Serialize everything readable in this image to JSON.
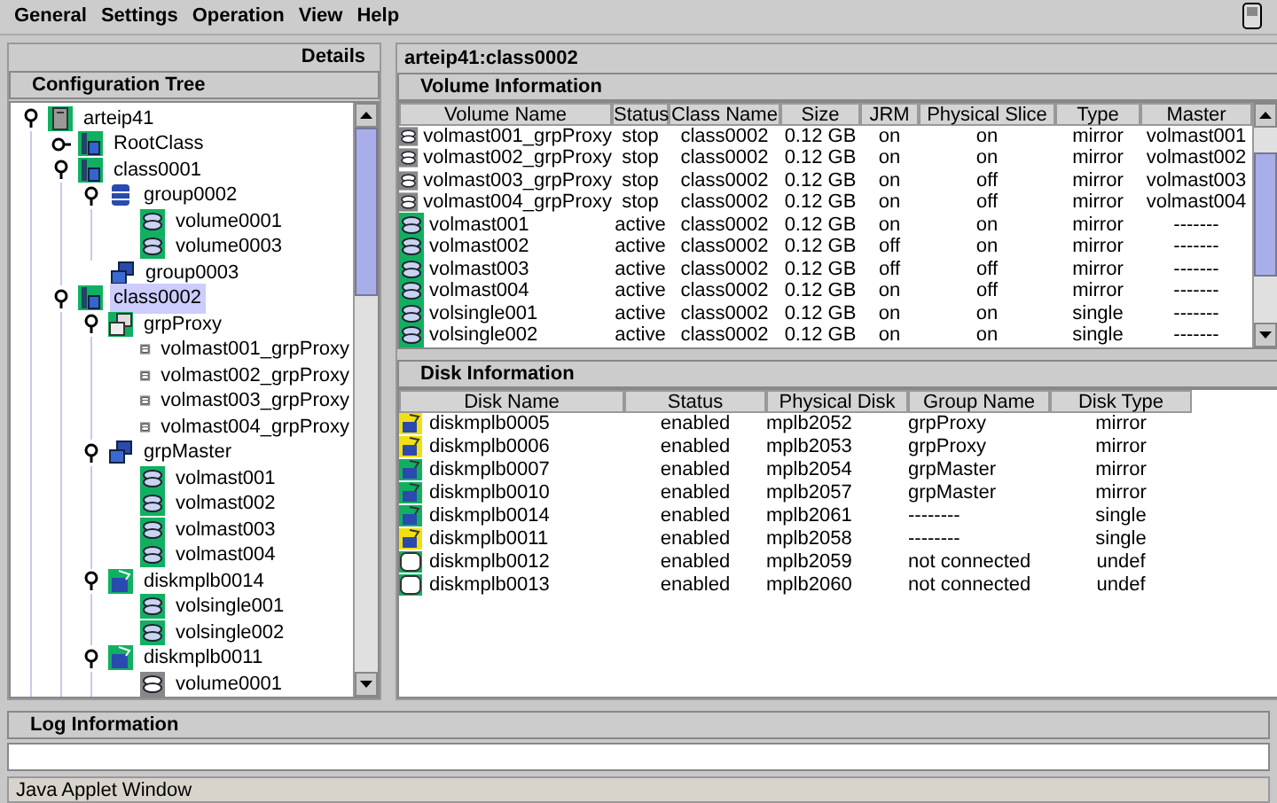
{
  "menu": [
    "General",
    "Settings",
    "Operation",
    "View",
    "Help"
  ],
  "left_panel": {
    "header": "Details",
    "title": "Configuration Tree",
    "tree": [
      {
        "label": "arteip41",
        "kind": "host",
        "expanded": true,
        "selected": false,
        "children": [
          {
            "label": "RootClass",
            "kind": "class",
            "expanded": false,
            "selected": false
          },
          {
            "label": "class0001",
            "kind": "class",
            "expanded": true,
            "selected": false,
            "children": [
              {
                "label": "group0002",
                "kind": "group",
                "expanded": true,
                "selected": false,
                "children": [
                  {
                    "label": "volume0001",
                    "kind": "volume_active",
                    "selected": false
                  },
                  {
                    "label": "volume0003",
                    "kind": "volume_active",
                    "selected": false
                  }
                ]
              },
              {
                "label": "group0003",
                "kind": "group2",
                "selected": false
              }
            ]
          },
          {
            "label": "class0002",
            "kind": "class",
            "expanded": true,
            "selected": true,
            "children": [
              {
                "label": "grpProxy",
                "kind": "group_proxy",
                "expanded": true,
                "selected": false,
                "children": [
                  {
                    "label": "volmast001_grpProxy",
                    "kind": "volume_stopped",
                    "selected": false
                  },
                  {
                    "label": "volmast002_grpProxy",
                    "kind": "volume_stopped",
                    "selected": false
                  },
                  {
                    "label": "volmast003_grpProxy",
                    "kind": "volume_stopped",
                    "selected": false
                  },
                  {
                    "label": "volmast004_grpProxy",
                    "kind": "volume_stopped",
                    "selected": false
                  }
                ]
              },
              {
                "label": "grpMaster",
                "kind": "group2",
                "expanded": true,
                "selected": false,
                "children": [
                  {
                    "label": "volmast001",
                    "kind": "volume_active",
                    "selected": false
                  },
                  {
                    "label": "volmast002",
                    "kind": "volume_active",
                    "selected": false
                  },
                  {
                    "label": "volmast003",
                    "kind": "volume_active",
                    "selected": false
                  },
                  {
                    "label": "volmast004",
                    "kind": "volume_active",
                    "selected": false
                  }
                ]
              },
              {
                "label": "diskmplb0014",
                "kind": "disk",
                "expanded": true,
                "selected": false,
                "children": [
                  {
                    "label": "volsingle001",
                    "kind": "volume_active",
                    "selected": false
                  },
                  {
                    "label": "volsingle002",
                    "kind": "volume_active",
                    "selected": false
                  }
                ]
              },
              {
                "label": "diskmplb0011",
                "kind": "disk",
                "expanded": true,
                "selected": false,
                "children": [
                  {
                    "label": "volume0001",
                    "kind": "volume_stopped",
                    "selected": false
                  }
                ]
              }
            ]
          }
        ]
      }
    ]
  },
  "path_title": "arteip41:class0002",
  "volume_info": {
    "title": "Volume Information",
    "columns": [
      "Volume Name",
      "Status",
      "Class Name",
      "Size",
      "JRM",
      "Physical Slice",
      "Type",
      "Master"
    ],
    "rows": [
      {
        "kind": "stopped",
        "cells": [
          "volmast001_grpProxy",
          "stop",
          "class0002",
          "0.12 GB",
          "on",
          "on",
          "mirror",
          "volmast001"
        ]
      },
      {
        "kind": "stopped",
        "cells": [
          "volmast002_grpProxy",
          "stop",
          "class0002",
          "0.12 GB",
          "on",
          "on",
          "mirror",
          "volmast002"
        ]
      },
      {
        "kind": "stopped",
        "cells": [
          "volmast003_grpProxy",
          "stop",
          "class0002",
          "0.12 GB",
          "on",
          "off",
          "mirror",
          "volmast003"
        ]
      },
      {
        "kind": "stopped",
        "cells": [
          "volmast004_grpProxy",
          "stop",
          "class0002",
          "0.12 GB",
          "on",
          "off",
          "mirror",
          "volmast004"
        ]
      },
      {
        "kind": "active",
        "cells": [
          "volmast001",
          "active",
          "class0002",
          "0.12 GB",
          "on",
          "on",
          "mirror",
          "-------"
        ]
      },
      {
        "kind": "active",
        "cells": [
          "volmast002",
          "active",
          "class0002",
          "0.12 GB",
          "off",
          "on",
          "mirror",
          "-------"
        ]
      },
      {
        "kind": "active",
        "cells": [
          "volmast003",
          "active",
          "class0002",
          "0.12 GB",
          "off",
          "off",
          "mirror",
          "-------"
        ]
      },
      {
        "kind": "active",
        "cells": [
          "volmast004",
          "active",
          "class0002",
          "0.12 GB",
          "on",
          "off",
          "mirror",
          "-------"
        ]
      },
      {
        "kind": "active",
        "cells": [
          "volsingle001",
          "active",
          "class0002",
          "0.12 GB",
          "on",
          "on",
          "single",
          "-------"
        ]
      },
      {
        "kind": "active",
        "cells": [
          "volsingle002",
          "active",
          "class0002",
          "0.12 GB",
          "on",
          "on",
          "single",
          "-------"
        ]
      }
    ]
  },
  "disk_info": {
    "title": "Disk Information",
    "columns": [
      "Disk Name",
      "Status",
      "Physical Disk",
      "Group Name",
      "Disk Type"
    ],
    "rows": [
      {
        "kind": "disk",
        "color": "#f0e010",
        "cells": [
          "diskmplb0005",
          "enabled",
          "mplb2052",
          "grpProxy",
          "mirror"
        ]
      },
      {
        "kind": "disk",
        "color": "#f0e010",
        "cells": [
          "diskmplb0006",
          "enabled",
          "mplb2053",
          "grpProxy",
          "mirror"
        ]
      },
      {
        "kind": "disk",
        "color": "#10b060",
        "cells": [
          "diskmplb0007",
          "enabled",
          "mplb2054",
          "grpMaster",
          "mirror"
        ]
      },
      {
        "kind": "disk",
        "color": "#10b060",
        "cells": [
          "diskmplb0010",
          "enabled",
          "mplb2057",
          "grpMaster",
          "mirror"
        ]
      },
      {
        "kind": "disk",
        "color": "#10b060",
        "cells": [
          "diskmplb0014",
          "enabled",
          "mplb2061",
          "--------",
          "single"
        ]
      },
      {
        "kind": "disk",
        "color": "#f0e010",
        "cells": [
          "diskmplb0011",
          "enabled",
          "mplb2058",
          "--------",
          "single"
        ]
      },
      {
        "kind": "undef",
        "color": "#10b060",
        "cells": [
          "diskmplb0012",
          "enabled",
          "mplb2059",
          "not connected",
          "undef"
        ]
      },
      {
        "kind": "undef",
        "color": "#10b060",
        "cells": [
          "diskmplb0013",
          "enabled",
          "mplb2060",
          "not connected",
          "undef"
        ]
      }
    ]
  },
  "log": {
    "title": "Log Information"
  },
  "status_bar": "Java Applet Window"
}
